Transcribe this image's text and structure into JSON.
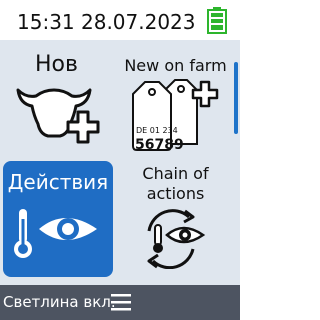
{
  "status": {
    "datetime": "15:31 28.07.2023",
    "battery_icon": "battery-full-icon",
    "battery_color": "#2db52d"
  },
  "tiles": [
    {
      "label": "Нов",
      "icon": "cow-add-icon"
    },
    {
      "label": "New on farm",
      "icon": "ear-tags-add-icon",
      "tag_country_line": "DE 01 234",
      "tag_number": "56789"
    },
    {
      "label": "Действия",
      "icon": "thermometer-eye-icon",
      "selected": true,
      "accent": "#1f6dc4"
    },
    {
      "label": "Chain of actions",
      "icon": "cycle-thermometer-eye-icon"
    }
  ],
  "bottom_bar": {
    "label": "Светлина вкл.",
    "menu_icon": "hamburger-menu-icon"
  }
}
